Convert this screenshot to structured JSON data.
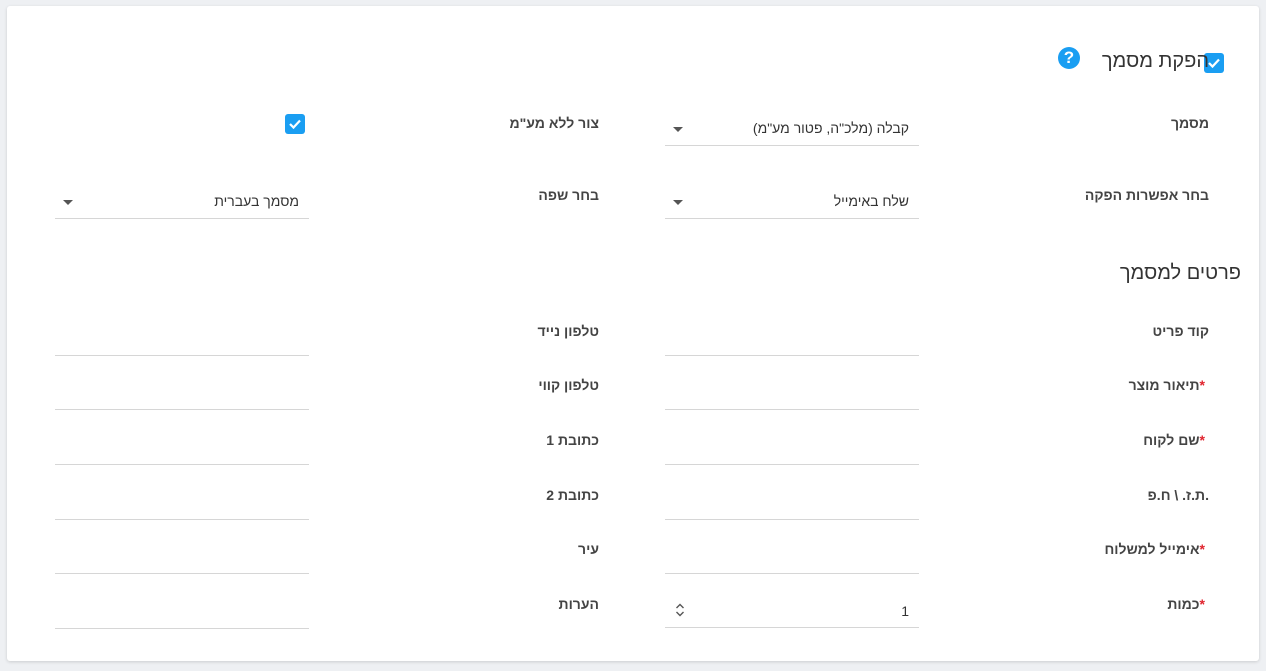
{
  "header": {
    "title": "הפקת מסמך",
    "enabled": true,
    "help_icon": "question-circle-icon",
    "help_glyph": "?"
  },
  "document": {
    "label": "מסמך",
    "value": "קבלה (מלכ\"ה, פטור מע\"מ)"
  },
  "no_vat": {
    "label": "צור ללא מע\"מ",
    "checked": true
  },
  "issue_option": {
    "label": "בחר אפשרות הפקה",
    "value": "שלח באימייל"
  },
  "language": {
    "label": "בחר שפה",
    "value": "מסמך בעברית"
  },
  "details": {
    "title": "פרטים למסמך",
    "required_mark": "*",
    "fields": {
      "item_code": "קוד פריט",
      "product_description": "תיאור מוצר",
      "customer_name": "שם לקוח",
      "id_number": "ת.ז. \\ ח.פ.",
      "delivery_email": "אימייל למשלוח",
      "quantity": "כמות",
      "mobile_phone": "טלפון נייד",
      "landline_phone": "טלפון קווי",
      "address1": "כתובת 1",
      "address2": "כתובת 2",
      "city": "עיר",
      "notes": "הערות"
    },
    "quantity_value": "1"
  },
  "colors": {
    "accent": "#1a9ef2",
    "required": "#e0242e"
  }
}
